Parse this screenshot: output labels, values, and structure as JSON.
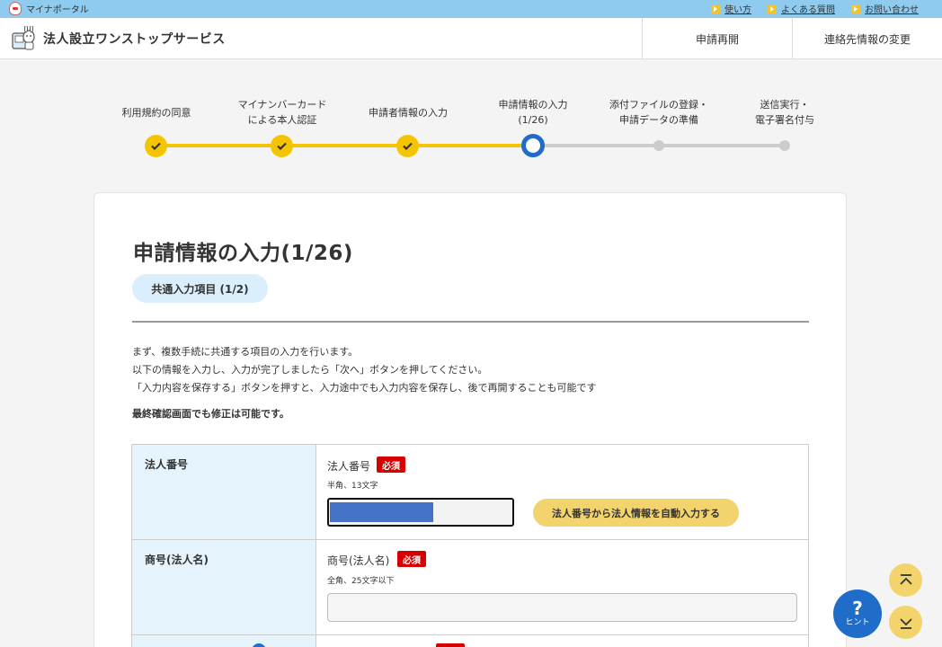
{
  "topbar": {
    "portal_label": "マイナポータル",
    "links": [
      "使い方",
      "よくある質問",
      "お問い合わせ"
    ]
  },
  "header": {
    "title": "法人設立ワンストップサービス",
    "nav": [
      "申請再開",
      "連絡先情報の変更"
    ]
  },
  "stepper": {
    "steps": [
      {
        "line1": "利用規約の同意",
        "line2": "",
        "state": "done"
      },
      {
        "line1": "マイナンバーカード",
        "line2": "による本人認証",
        "state": "done"
      },
      {
        "line1": "申請者情報の入力",
        "line2": "",
        "state": "done"
      },
      {
        "line1": "申請情報の入力",
        "line2": "(1/26)",
        "state": "current"
      },
      {
        "line1": "添付ファイルの登録・",
        "line2": "申請データの準備",
        "state": "todo"
      },
      {
        "line1": "送信実行・",
        "line2": "電子署名付与",
        "state": "todo"
      }
    ]
  },
  "main": {
    "title": "申請情報の入力(1/26)",
    "section_pill": "共通入力項目 (1/2)",
    "intro": [
      "まず、複数手続に共通する項目の入力を行います。",
      "以下の情報を入力し、入力が完了しましたら「次へ」ボタンを押してください。",
      "「入力内容を保存する」ボタンを押すと、入力途中でも入力内容を保存し、後で再開することも可能です"
    ],
    "intro_bold": "最終確認画面でも修正は可能です。"
  },
  "form": {
    "rows": [
      {
        "label": "法人番号",
        "field_label": "法人番号",
        "required": "必須",
        "hint": "半角、13文字",
        "button": "法人番号から法人情報を自動入力する"
      },
      {
        "label": "商号(法人名)",
        "field_label": "商号(法人名)",
        "required": "必須",
        "hint": "全角、25文字以下"
      }
    ]
  },
  "fab": {
    "hint_label": "ヒント",
    "hint_mark": "?"
  },
  "colors": {
    "accent_yellow": "#f5c400",
    "current_blue": "#1f6cc9",
    "required_red": "#d60000",
    "topbar_blue": "#8ecbee"
  }
}
